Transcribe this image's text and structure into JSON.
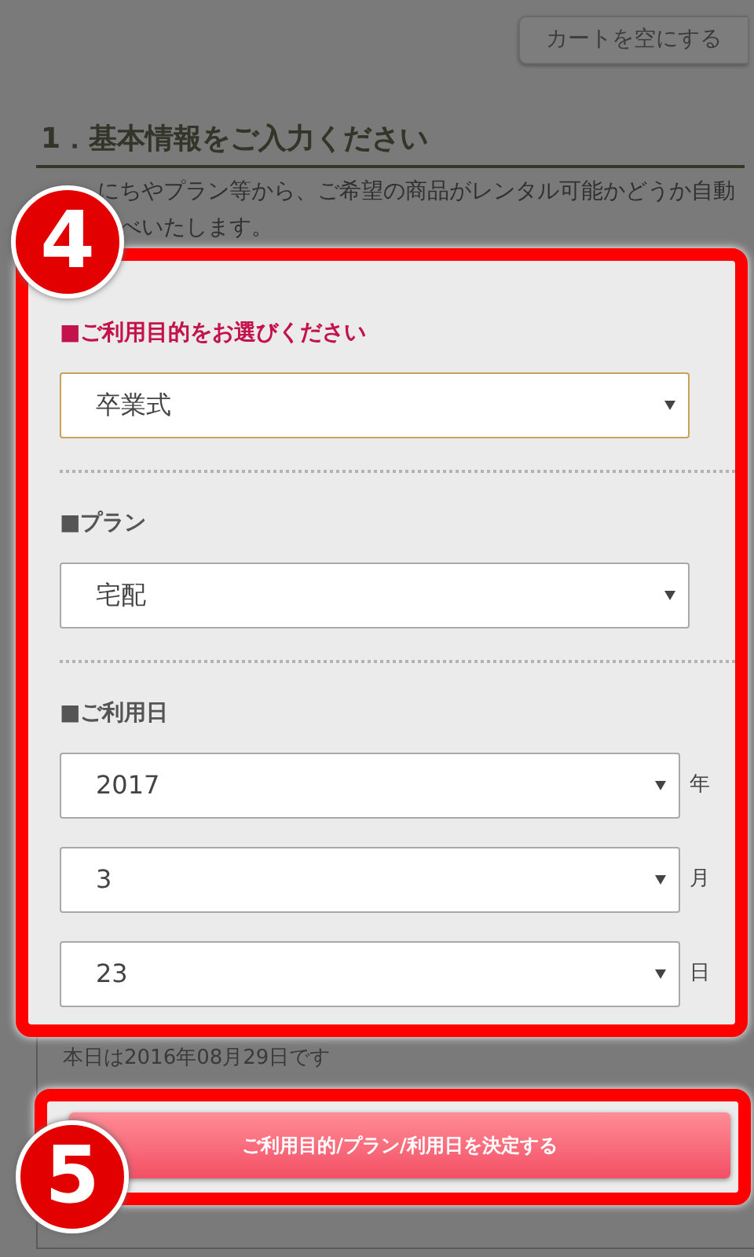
{
  "header": {
    "button": "カートを空にする"
  },
  "section": {
    "heading": "1．基本情報をご入力ください",
    "intro_lines": [
      "にちやプラン等から、ご希望の商品がレンタル可能かどうか自動",
      "べいたします。"
    ]
  },
  "form": {
    "groups": [
      {
        "kind": "single",
        "label": "■ご利用目的をお選びください",
        "active": true,
        "selects": [
          {
            "value": "卒業式"
          }
        ]
      },
      {
        "kind": "single",
        "label": "■プラン",
        "active": false,
        "selects": [
          {
            "value": "宅配"
          }
        ]
      },
      {
        "kind": "date",
        "label": "■ご利用日",
        "active": false,
        "selects": [
          {
            "value": "2017",
            "unit": "年"
          },
          {
            "value": "3",
            "unit": "月"
          },
          {
            "value": "23",
            "unit": "日"
          }
        ]
      }
    ]
  },
  "today_note": "本日は2016年08月29日です",
  "submit_button": "ご利用目的/プラン/利用日を決定する",
  "callouts": [
    "4",
    "5"
  ]
}
